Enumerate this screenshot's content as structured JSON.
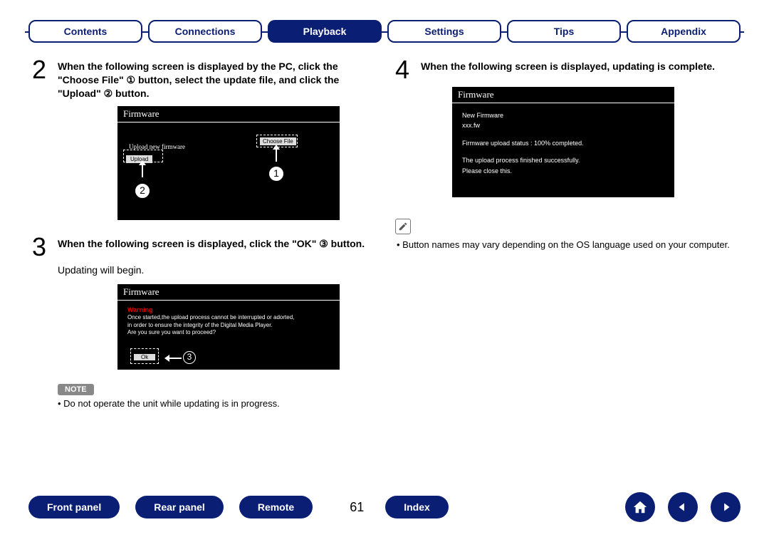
{
  "nav": {
    "contents": "Contents",
    "connections": "Connections",
    "playback": "Playback",
    "settings": "Settings",
    "tips": "Tips",
    "appendix": "Appendix"
  },
  "step2": {
    "num": "2",
    "text": "When the following screen is displayed by the PC, click the \"Choose File\" ① button, select the update file, and click the \"Upload\" ② button."
  },
  "shot1": {
    "title": "Firmware",
    "upload_label": "Upload new firmware",
    "choose_file": "Choose File",
    "upload": "Upload"
  },
  "circ1": "1",
  "circ2": "2",
  "circ3": "3",
  "step3": {
    "num": "3",
    "text": "When the following screen is displayed, click the \"OK\" ③ button.",
    "sub": "Updating will begin."
  },
  "shot2": {
    "title": "Firmware",
    "warn": "Warning",
    "line1": "Once started,the upload process cannot be interrupted or adorted,",
    "line2": "in order to ensure the integrity of the Digital Media Player.",
    "line3": "Are you sure you want to proceed?",
    "ok": "Ok"
  },
  "note_label": "NOTE",
  "note_text": "Do not operate the unit while updating is in progress.",
  "step4": {
    "num": "4",
    "text": "When the following screen is displayed, updating is complete."
  },
  "shot3": {
    "title": "Firmware",
    "l1": "New Firmware",
    "l2": "xxx.fw",
    "l3": "Firmware upload status : 100% completed.",
    "l4": "The upload process finished successfully.",
    "l5": "Please close this."
  },
  "right_note": "Button names may vary depending on the OS language used on your computer.",
  "footer": {
    "front": "Front panel",
    "rear": "Rear panel",
    "remote": "Remote",
    "index": "Index",
    "page": "61"
  }
}
